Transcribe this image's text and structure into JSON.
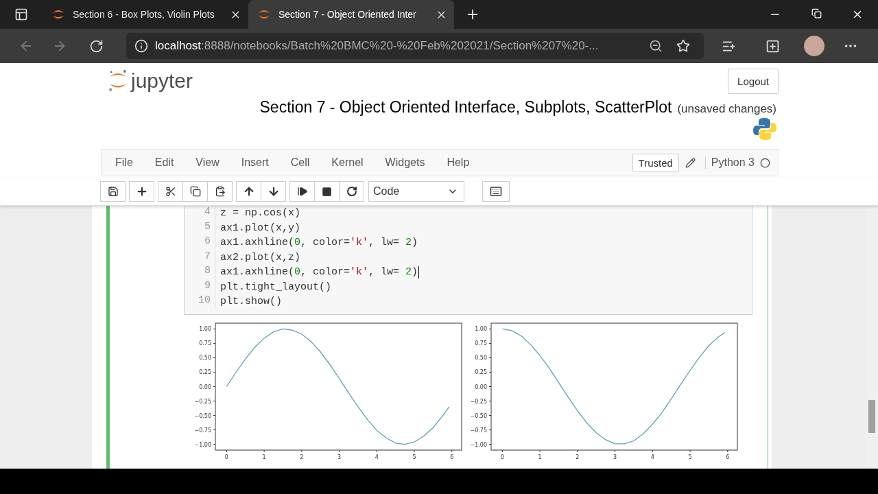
{
  "browser": {
    "tabs": [
      {
        "title": "Section 6 - Box Plots, Violin Plots",
        "selected": false
      },
      {
        "title": "Section 7 - Object Oriented Inter",
        "selected": true
      }
    ],
    "url": {
      "host": "localhost",
      "path": ":8888/notebooks/Batch%20BMC%20-%20Feb%202021/Section%207%20-..."
    }
  },
  "header": {
    "logo_text": "jupyter",
    "logout": "Logout",
    "notebook_title": "Section 7 - Object Oriented Interface, Subplots, ScatterPlot",
    "save_status": "(unsaved changes)"
  },
  "menu": [
    "File",
    "Edit",
    "View",
    "Insert",
    "Cell",
    "Kernel",
    "Widgets",
    "Help"
  ],
  "trusted": "Trusted",
  "kernel": {
    "name": "Python 3",
    "busy": false
  },
  "cell_type": "Code",
  "cell": {
    "selected": true,
    "lines": [
      {
        "number": "4",
        "caret": false,
        "tokens": [
          {
            "kind": "plain",
            "text": "z = np.cos(x)"
          }
        ]
      },
      {
        "number": "5",
        "caret": false,
        "tokens": [
          {
            "kind": "plain",
            "text": "ax1.plot(x,y)"
          }
        ]
      },
      {
        "number": "6",
        "caret": false,
        "tokens": [
          {
            "kind": "plain",
            "text": "ax1.axhline("
          },
          {
            "kind": "number",
            "text": "0"
          },
          {
            "kind": "plain",
            "text": ", color="
          },
          {
            "kind": "string",
            "text": "'k'"
          },
          {
            "kind": "plain",
            "text": ", lw= "
          },
          {
            "kind": "number",
            "text": "2"
          },
          {
            "kind": "plain",
            "text": ")"
          }
        ]
      },
      {
        "number": "7",
        "caret": false,
        "tokens": [
          {
            "kind": "plain",
            "text": "ax2.plot(x,z)"
          }
        ]
      },
      {
        "number": "8",
        "caret": true,
        "tokens": [
          {
            "kind": "plain",
            "text": "ax1.axhline("
          },
          {
            "kind": "number",
            "text": "0"
          },
          {
            "kind": "plain",
            "text": ", color="
          },
          {
            "kind": "string",
            "text": "'k'"
          },
          {
            "kind": "plain",
            "text": ", lw= "
          },
          {
            "kind": "number",
            "text": "2"
          },
          {
            "kind": "plain",
            "text": ")"
          }
        ]
      },
      {
        "number": "9",
        "caret": false,
        "tokens": [
          {
            "kind": "plain",
            "text": "plt.tight_layout()"
          }
        ]
      },
      {
        "number": "10",
        "caret": false,
        "tokens": [
          {
            "kind": "plain",
            "text": "plt.show()"
          }
        ]
      }
    ]
  },
  "outputs": [
    {
      "chart_data": {
        "type": "line",
        "x": [
          0,
          0.25,
          0.5,
          0.75,
          1,
          1.25,
          1.5,
          1.75,
          2,
          2.25,
          2.5,
          2.75,
          3,
          3.25,
          3.5,
          3.75,
          4,
          4.25,
          4.5,
          4.75,
          5,
          5.25,
          5.5,
          5.75,
          5.93
        ],
        "series": [
          {
            "color": "#5f9fb5",
            "values": [
              0,
              0.25,
              0.48,
              0.68,
              0.84,
              0.95,
              1.0,
              0.98,
              0.91,
              0.78,
              0.6,
              0.38,
              0.14,
              -0.11,
              -0.35,
              -0.57,
              -0.76,
              -0.89,
              -0.98,
              -1.0,
              -0.96,
              -0.86,
              -0.71,
              -0.51,
              -0.35
            ]
          }
        ],
        "xlim": [
          -0.3,
          6.26
        ],
        "ylim": [
          -1.1,
          1.1
        ],
        "xticks": [
          0,
          1,
          2,
          3,
          4,
          5,
          6
        ],
        "yticks": [
          {
            "value": 1,
            "label": "1.00"
          },
          {
            "value": 0.75,
            "label": "0.75"
          },
          {
            "value": 0.5,
            "label": "0.50"
          },
          {
            "value": 0.25,
            "label": "0.25"
          },
          {
            "value": 0,
            "label": "0.00"
          },
          {
            "value": -0.25,
            "label": "−0.25"
          },
          {
            "value": -0.5,
            "label": "−0.50"
          },
          {
            "value": -0.75,
            "label": "−0.75"
          },
          {
            "value": -1,
            "label": "−1.00"
          }
        ]
      }
    },
    {
      "chart_data": {
        "type": "line",
        "x": [
          0,
          0.25,
          0.5,
          0.75,
          1,
          1.25,
          1.5,
          1.75,
          2,
          2.25,
          2.5,
          2.75,
          3,
          3.25,
          3.5,
          3.75,
          4,
          4.25,
          4.5,
          4.75,
          5,
          5.25,
          5.5,
          5.75,
          5.93
        ],
        "series": [
          {
            "color": "#5f9fb5",
            "values": [
              1,
              0.97,
              0.88,
              0.73,
              0.54,
              0.32,
              0.07,
              -0.18,
              -0.42,
              -0.63,
              -0.8,
              -0.92,
              -0.99,
              -0.99,
              -0.94,
              -0.82,
              -0.65,
              -0.45,
              -0.21,
              0.04,
              0.28,
              0.51,
              0.71,
              0.86,
              0.94
            ]
          }
        ],
        "xlim": [
          -0.3,
          6.26
        ],
        "ylim": [
          -1.1,
          1.1
        ],
        "xticks": [
          0,
          1,
          2,
          3,
          4,
          5,
          6
        ],
        "yticks": [
          {
            "value": 1,
            "label": "1.00"
          },
          {
            "value": 0.75,
            "label": "0.75"
          },
          {
            "value": 0.5,
            "label": "0.50"
          },
          {
            "value": 0.25,
            "label": "0.25"
          },
          {
            "value": 0,
            "label": "0.00"
          },
          {
            "value": -0.25,
            "label": "−0.25"
          },
          {
            "value": -0.5,
            "label": "−0.50"
          },
          {
            "value": -0.75,
            "label": "−0.75"
          },
          {
            "value": -1,
            "label": "−1.00"
          }
        ]
      }
    }
  ]
}
